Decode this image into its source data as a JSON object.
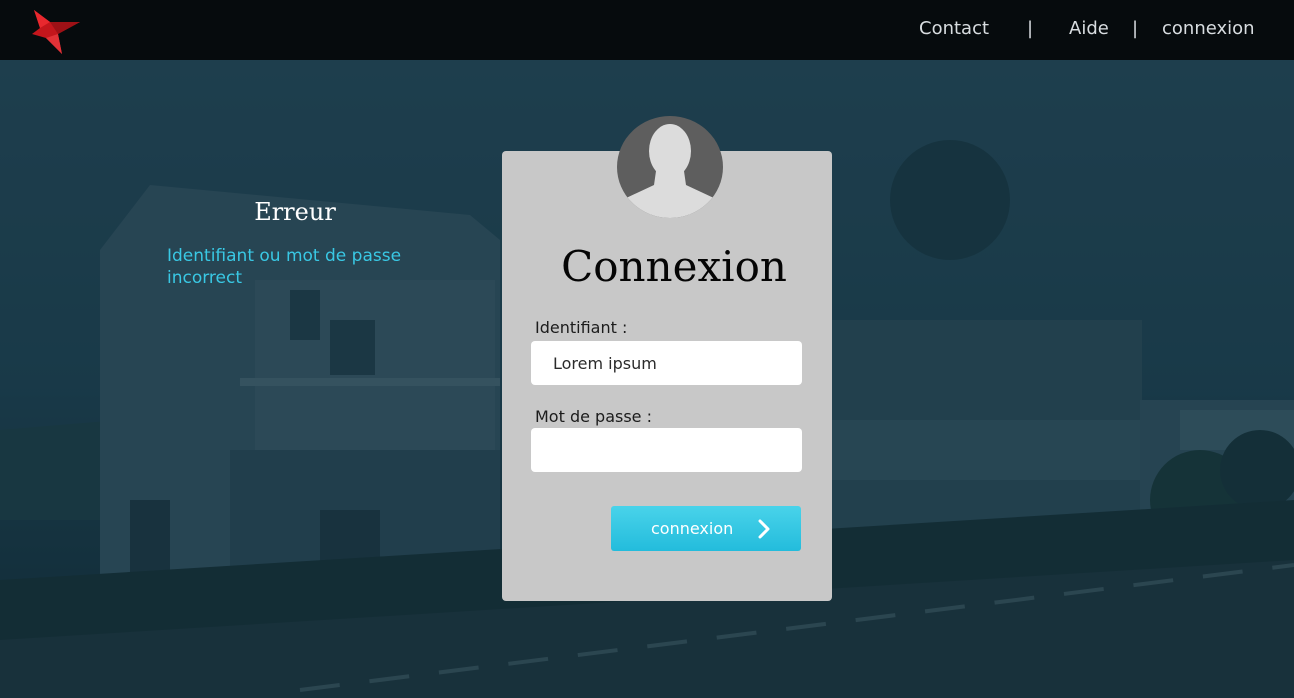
{
  "header": {
    "logo_icon": "red-bird-logo-icon",
    "nav": {
      "contact": "Contact",
      "separator_1": "|",
      "help": "Aide",
      "separator_2": "|",
      "login": "connexion"
    }
  },
  "error": {
    "title": "Erreur",
    "message": "Identifiant ou mot de passe incorrect",
    "message_color": "#39c8e4"
  },
  "login_form": {
    "avatar_icon": "user-avatar-icon",
    "title": "Connexion",
    "username_label": "Identifiant :",
    "username_value": "Lorem ipsum",
    "password_label": "Mot de passe :",
    "password_value": "",
    "submit_label": "connexion",
    "submit_icon": "chevron-right-icon",
    "accent_color": "#2ec4e1"
  }
}
